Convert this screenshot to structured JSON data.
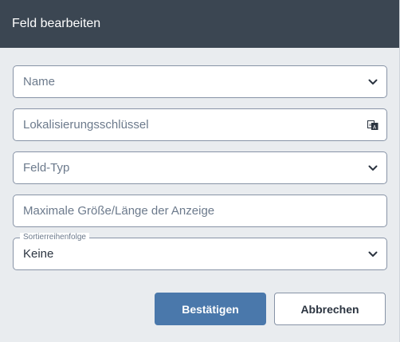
{
  "dialog": {
    "title": "Feld bearbeiten"
  },
  "form": {
    "name_placeholder": "Name",
    "localization_key_placeholder": "Lokalisierungsschlüssel",
    "field_type_placeholder": "Feld-Typ",
    "max_size_placeholder": "Maximale Größe/Länge der Anzeige",
    "sort_order_label": "Sortierreihenfolge",
    "sort_order_value": "Keine"
  },
  "buttons": {
    "confirm_label": "Bestätigen",
    "cancel_label": "Abbrechen"
  },
  "icons": {
    "dropdown": "chevron-down-icon",
    "translate": "translate-icon"
  },
  "colors": {
    "header_bg": "#3b4652",
    "primary_button": "#4a78ab",
    "body_bg": "#e9ecef"
  }
}
